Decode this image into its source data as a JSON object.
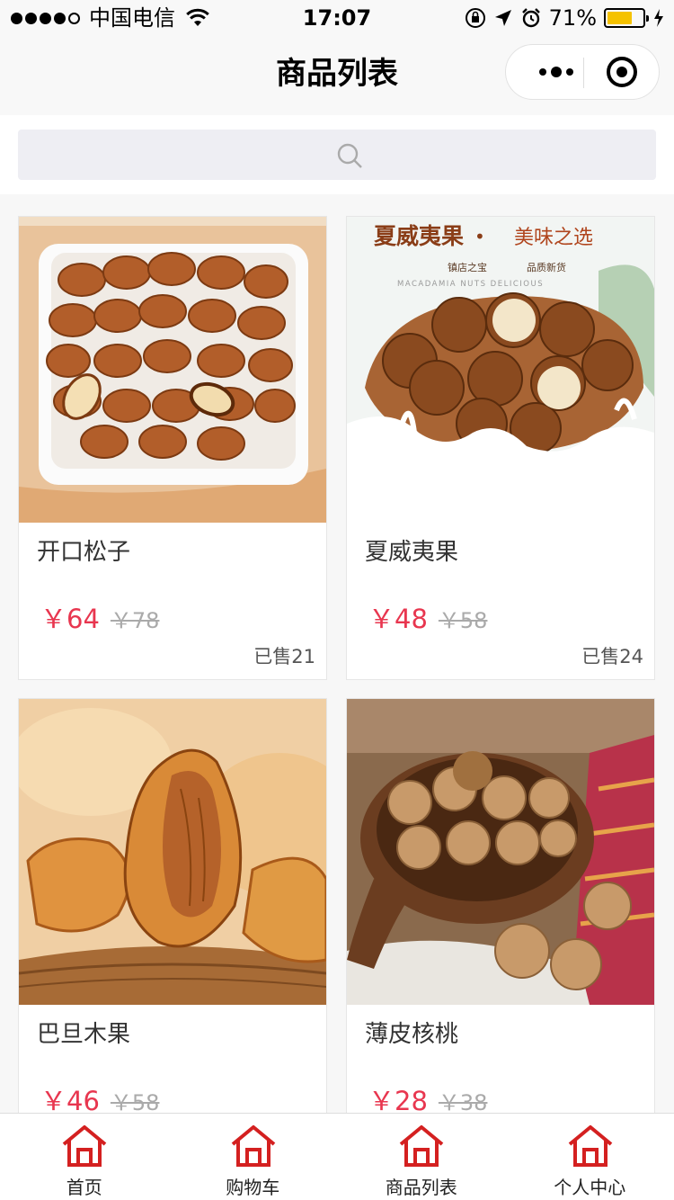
{
  "status_bar": {
    "carrier": "中国电信",
    "time": "17:07",
    "battery_percent": "71%",
    "battery_level": 0.71
  },
  "nav": {
    "title": "商品列表"
  },
  "search": {
    "placeholder": ""
  },
  "products": [
    {
      "name": "开口松子",
      "price": "￥64",
      "original_price": "￥78",
      "sold": "已售21"
    },
    {
      "name": "夏威夷果",
      "price": "￥48",
      "original_price": "￥58",
      "sold": "已售24",
      "banner": {
        "title": "夏威夷果",
        "slogan": "美味之选",
        "tag1": "镇店之宝",
        "tag2": "品质新货",
        "english": "MACADAMIA NUTS DELICIOUS"
      }
    },
    {
      "name": "巴旦木果",
      "price": "￥46",
      "original_price": "￥58"
    },
    {
      "name": "薄皮核桃",
      "price": "￥28",
      "original_price": "￥38"
    }
  ],
  "tabs": [
    {
      "label": "首页",
      "icon": "home-icon"
    },
    {
      "label": "购物车",
      "icon": "home-icon"
    },
    {
      "label": "商品列表",
      "icon": "home-icon"
    },
    {
      "label": "个人中心",
      "icon": "home-icon"
    }
  ],
  "colors": {
    "price": "#e8364f",
    "tab_icon": "#d42020",
    "battery": "#f5c200"
  }
}
